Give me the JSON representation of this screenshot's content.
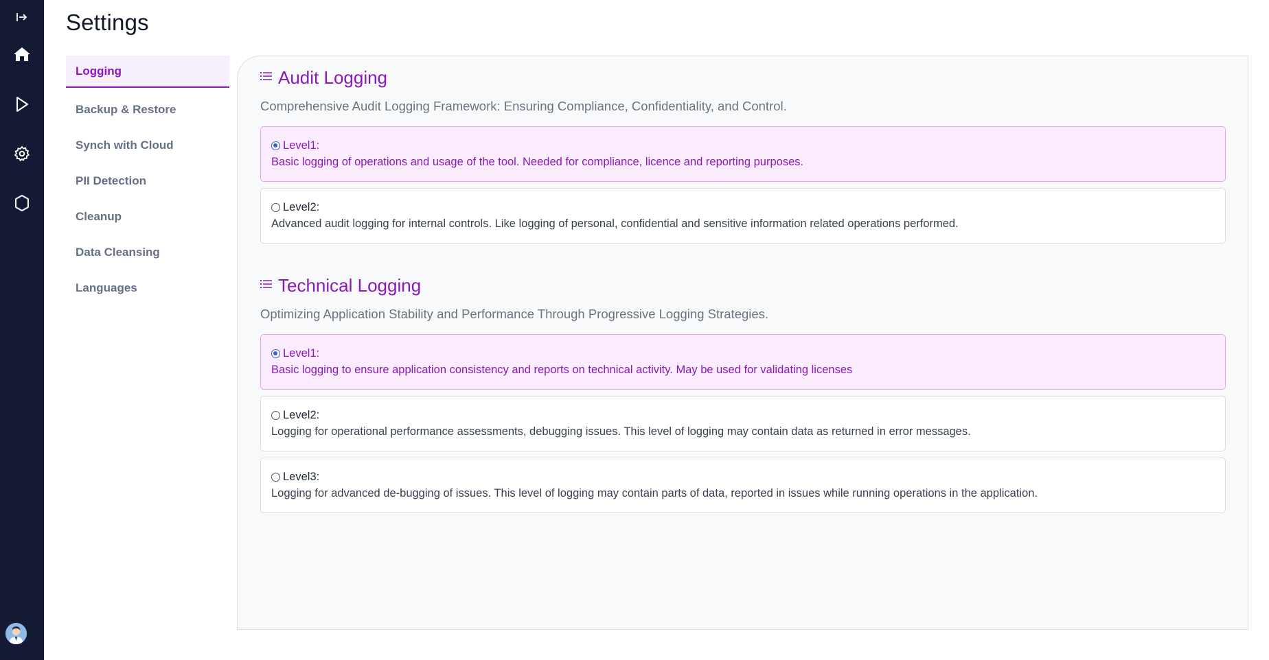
{
  "page": {
    "title": "Settings"
  },
  "rail": {
    "icons": [
      "expand-icon",
      "home-icon",
      "play-icon",
      "gear-icon",
      "hexagon-icon"
    ],
    "avatar": "avatar"
  },
  "settings_nav": {
    "items": [
      {
        "label": "Logging",
        "active": true
      },
      {
        "label": "Backup & Restore",
        "active": false
      },
      {
        "label": "Synch with Cloud",
        "active": false
      },
      {
        "label": "PII Detection",
        "active": false
      },
      {
        "label": "Cleanup",
        "active": false
      },
      {
        "label": "Data Cleansing",
        "active": false
      },
      {
        "label": "Languages",
        "active": false
      }
    ]
  },
  "audit": {
    "title": "Audit Logging",
    "description": "Comprehensive Audit Logging Framework: Ensuring Compliance, Confidentiality, and Control.",
    "options": [
      {
        "level": "Level1:",
        "description": "Basic logging of operations and usage of the tool. Needed for compliance, licence and reporting purposes.",
        "selected": true
      },
      {
        "level": "Level2:",
        "description": "Advanced audit logging for internal controls. Like logging of personal, confidential and sensitive information related operations performed.",
        "selected": false
      }
    ]
  },
  "technical": {
    "title": "Technical Logging",
    "description": "Optimizing Application Stability and Performance Through Progressive Logging Strategies.",
    "options": [
      {
        "level": "Level1:",
        "description": "Basic logging to ensure application consistency and reports on technical activity. May be used for validating licenses",
        "selected": true
      },
      {
        "level": "Level2:",
        "description": "Logging for operational performance assessments, debugging issues. This level of logging may contain data as returned in error messages.",
        "selected": false
      },
      {
        "level": "Level3:",
        "description": "Logging for advanced de-bugging of issues. This level of logging may contain parts of data, reported in issues while running operations in the application.",
        "selected": false
      }
    ]
  },
  "colors": {
    "rail_bg": "#141a33",
    "accent": "#8a19b8",
    "selected_bg": "#faecfc",
    "radio_blue": "#3b5bdb"
  }
}
